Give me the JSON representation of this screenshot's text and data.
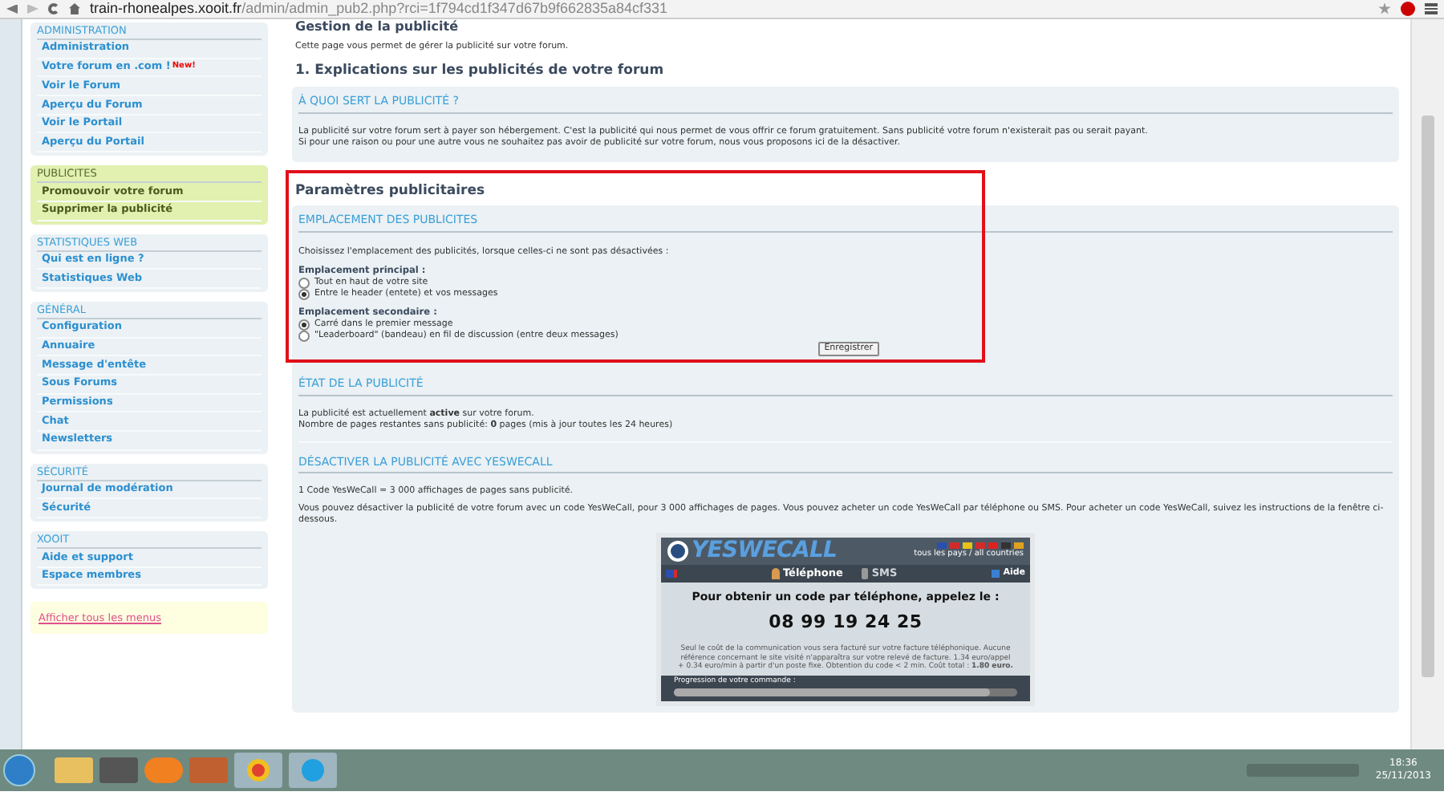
{
  "browser": {
    "url_host": "train-rhonealpes.xooit.fr",
    "url_path": "/admin/admin_pub2.php?rci=1f794cd1f347d67b9f662835a84cf331"
  },
  "sidebar": {
    "sections": [
      {
        "title": "ADMINISTRATION",
        "highlighted": false,
        "items": [
          {
            "label": "Administration"
          },
          {
            "label": "Votre forum en .com !",
            "badge": "New!"
          },
          {
            "label": "Voir le Forum"
          },
          {
            "label": "Aperçu du Forum"
          },
          {
            "label": "Voir le Portail"
          },
          {
            "label": "Aperçu du Portail"
          }
        ]
      },
      {
        "title": "PUBLICITES",
        "highlighted": true,
        "items": [
          {
            "label": "Promouvoir votre forum"
          },
          {
            "label": "Supprimer la publicité"
          }
        ]
      },
      {
        "title": "STATISTIQUES WEB",
        "highlighted": false,
        "items": [
          {
            "label": "Qui est en ligne ?"
          },
          {
            "label": "Statistiques Web"
          }
        ]
      },
      {
        "title": "GÉNÉRAL",
        "highlighted": false,
        "items": [
          {
            "label": "Configuration"
          },
          {
            "label": "Annuaire"
          },
          {
            "label": "Message d'entête"
          },
          {
            "label": "Sous Forums"
          },
          {
            "label": "Permissions"
          },
          {
            "label": "Chat"
          },
          {
            "label": "Newsletters"
          }
        ]
      },
      {
        "title": "SÉCURITÉ",
        "highlighted": false,
        "items": [
          {
            "label": "Journal de modération"
          },
          {
            "label": "Sécurité"
          }
        ]
      },
      {
        "title": "XOOIT",
        "highlighted": false,
        "items": [
          {
            "label": "Aide et support"
          },
          {
            "label": "Espace membres"
          }
        ]
      }
    ],
    "show_all_link": "Afficher tous les menus"
  },
  "page": {
    "title": "Gestion de la publicité",
    "intro": "Cette page vous permet de gérer la publicité sur votre forum.",
    "section1_title": "1. Explications sur les publicités de votre forum",
    "explain_panel": {
      "heading": "À QUOI SERT LA PUBLICITÉ ?",
      "lines": [
        "La publicité sur votre forum sert à payer son hébergement. C'est la publicité qui nous permet de vous offrir ce forum gratuitement. Sans publicité votre forum n'existerait pas ou serait payant.",
        "Si pour une raison ou pour une autre vous ne souhaitez pas avoir de publicité sur votre forum, nous vous proposons ici de la désactiver."
      ]
    },
    "settings": {
      "title": "Paramètres publicitaires",
      "highlighted": true,
      "heading": "EMPLACEMENT DES PUBLICITES",
      "intro": "Choisissez l'emplacement des publicités, lorsque celles-ci ne sont pas désactivées :",
      "groups": [
        {
          "label": "Emplacement principal :",
          "options": [
            {
              "label": "Tout en haut de votre site",
              "selected": false
            },
            {
              "label": "Entre le header (entete) et vos messages",
              "selected": true
            }
          ]
        },
        {
          "label": "Emplacement secondaire :",
          "options": [
            {
              "label": "Carré dans le premier message",
              "selected": true
            },
            {
              "label": "\"Leaderboard\" (bandeau) en fil de discussion (entre deux messages)",
              "selected": false
            }
          ]
        }
      ],
      "save_button": "Enregistrer"
    },
    "state": {
      "heading": "ÉTAT DE LA PUBLICITÉ",
      "lines": [
        "La publicité est actuellement **active** sur votre forum.",
        "Nombre de pages restantes sans publicité: **0** pages (mis à jour toutes les 24 heures)"
      ]
    },
    "deactivate": {
      "heading": "DÉSACTIVER LA PUBLICITÉ AVEC YESWECALL",
      "lines": [
        "1 Code YesWeCall = 3 000 affichages de pages sans publicité.",
        "Vous pouvez désactiver la publicité de votre forum avec un code YesWeCall, pour 3 000 affichages de pages. Vous pouvez acheter un code YesWeCall par téléphone ou SMS. Pour acheter un code YesWeCall, suivez les instructions de la fenêtre ci-dessous."
      ]
    },
    "widget": {
      "logo": "YESWECALL",
      "countries": "tous les pays / all countries",
      "flags": [
        {
          "color": "#2b4fb0"
        },
        {
          "color": "#d22b2b"
        },
        {
          "color": "#e8c21a"
        },
        {
          "color": "#d22b2b"
        },
        {
          "color": "#e02020"
        },
        {
          "color": "#333333"
        },
        {
          "color": "#e0a020"
        }
      ],
      "tabs": [
        {
          "label": "Téléphone",
          "kind": "phone",
          "selected": true
        },
        {
          "label": "SMS",
          "kind": "sms",
          "selected": false
        }
      ],
      "help": "Aide",
      "headline": "Pour obtenir un code par téléphone, appelez le :",
      "phone": "08 99 19 24 25",
      "fine_print": "Seul le coût de la communication vous sera facturé sur votre facture téléphonique. Aucune référence concernant le site visité n'apparaîtra sur votre relevé de facture. 1.34 euro/appel + 0.34 euro/min à partir d'un poste fixe. Obtention du code < 2 min. Coût total : **1.80 euro.**",
      "progress_label": "Progression de votre commande :",
      "progress": {
        "level": 0.92
      }
    }
  },
  "taskbar": {
    "time": "18:36",
    "date": "25/11/2013"
  }
}
